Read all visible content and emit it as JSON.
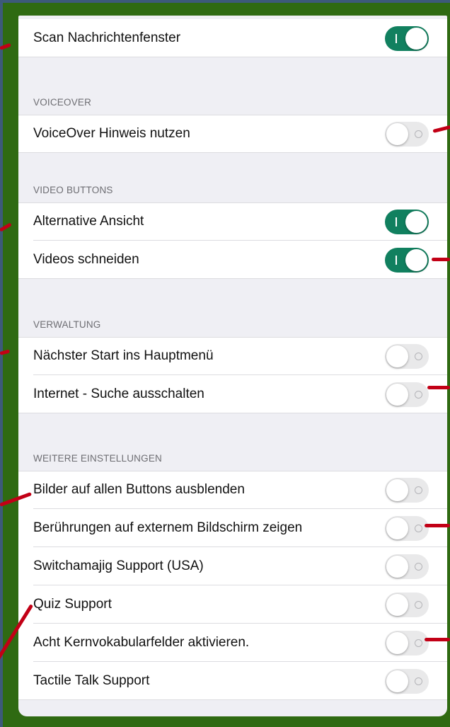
{
  "sections": {
    "top": {
      "items": [
        {
          "label": "Scan Nachrichtenfenster",
          "on": true
        }
      ]
    },
    "voiceover": {
      "header": "VOICEOVER",
      "items": [
        {
          "label": "VoiceOver Hinweis nutzen",
          "on": false
        }
      ]
    },
    "video_buttons": {
      "header": "VIDEO BUTTONS",
      "items": [
        {
          "label": "Alternative Ansicht",
          "on": true
        },
        {
          "label": "Videos schneiden",
          "on": true
        }
      ]
    },
    "verwaltung": {
      "header": "VERWALTUNG",
      "items": [
        {
          "label": "Nächster Start ins Hauptmenü",
          "on": false
        },
        {
          "label": "Internet - Suche ausschalten",
          "on": false
        }
      ]
    },
    "weitere": {
      "header": "WEITERE EINSTELLUNGEN",
      "items": [
        {
          "label": "Bilder auf allen Buttons ausblenden",
          "on": false
        },
        {
          "label": "Berührungen auf externem Bildschirm zeigen",
          "on": false
        },
        {
          "label": "Switchamajig Support (USA)",
          "on": false
        },
        {
          "label": "Quiz Support",
          "on": false
        },
        {
          "label": "Acht Kernvokabularfelder aktivieren.",
          "on": false
        },
        {
          "label": "Tactile Talk Support",
          "on": false
        }
      ]
    }
  },
  "colors": {
    "toggle_on": "#11805f",
    "toggle_off": "#e9e9ea",
    "frame": "#2f6a12",
    "annotation": "#c20016"
  }
}
